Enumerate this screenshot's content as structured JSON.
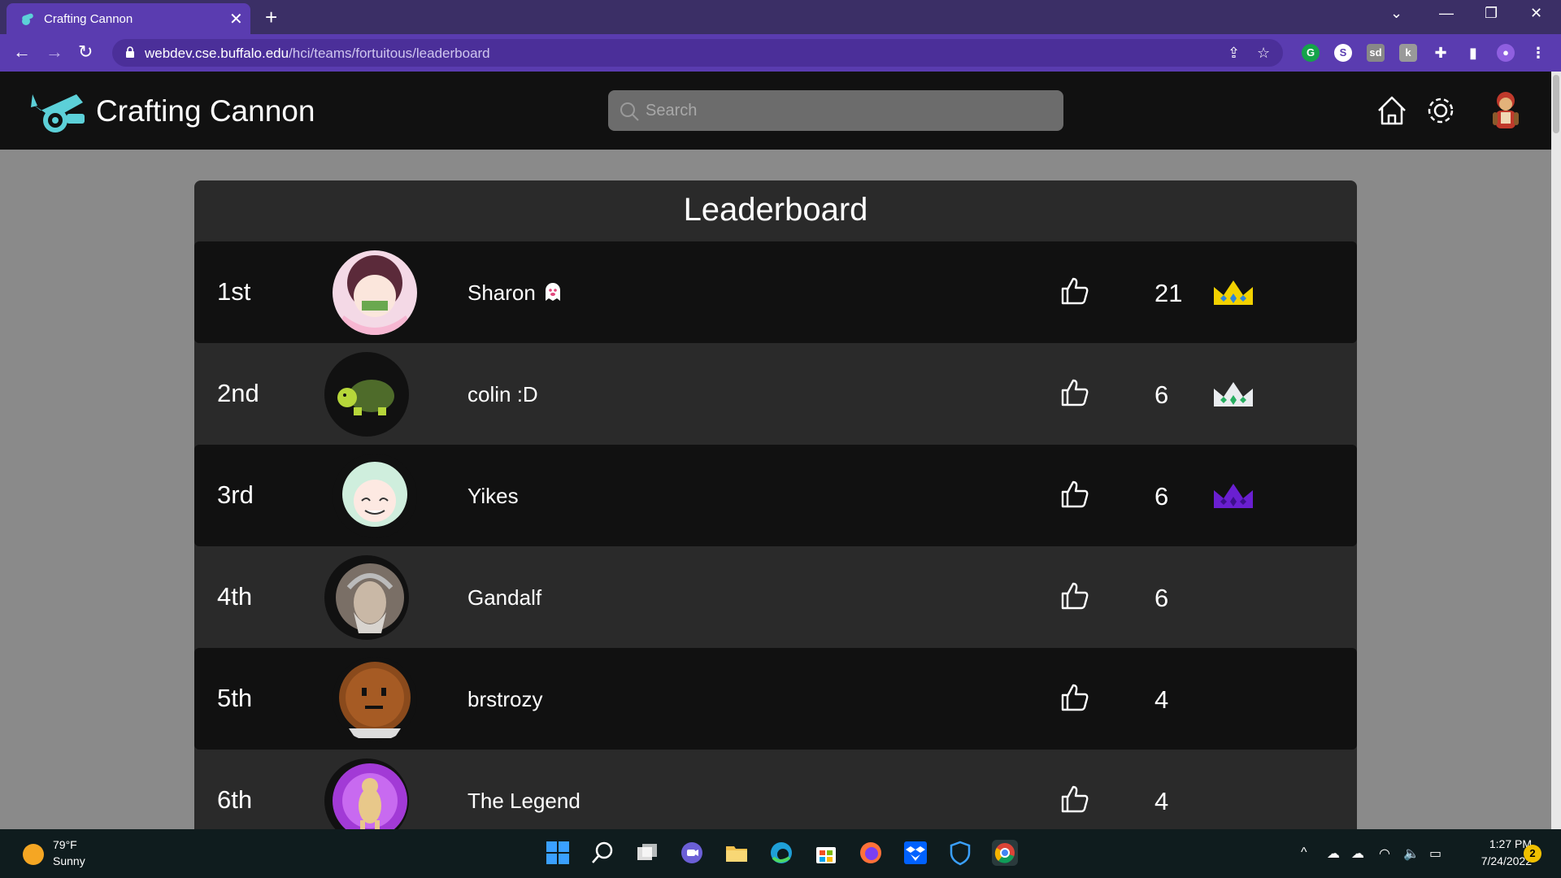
{
  "browser": {
    "tab_title": "Crafting Cannon",
    "tab_close": "✕",
    "new_tab": "+",
    "url_host": "webdev.cse.buffalo.edu",
    "url_path": "/hci/teams/fortuitous/leaderboard",
    "accent_color": "#5a3cb0"
  },
  "header": {
    "app_title": "Crafting Cannon",
    "search_placeholder": "Search",
    "logo_color": "#5cd0d8"
  },
  "leaderboard": {
    "title": "Leaderboard",
    "rows": [
      {
        "rank": "1st",
        "name": "Sharon",
        "likes": "21",
        "crown": "gold",
        "badge": "ghost-icon"
      },
      {
        "rank": "2nd",
        "name": "colin :D",
        "likes": "6",
        "crown": "silver"
      },
      {
        "rank": "3rd",
        "name": "Yikes",
        "likes": "6",
        "crown": "purple"
      },
      {
        "rank": "4th",
        "name": "Gandalf",
        "likes": "6"
      },
      {
        "rank": "5th",
        "name": "brstrozy",
        "likes": "4"
      },
      {
        "rank": "6th",
        "name": "The Legend",
        "likes": "4"
      }
    ]
  },
  "taskbar": {
    "weather_temp": "79°F",
    "weather_desc": "Sunny",
    "time": "1:27 PM",
    "date": "7/24/2022",
    "notifications": "2"
  }
}
